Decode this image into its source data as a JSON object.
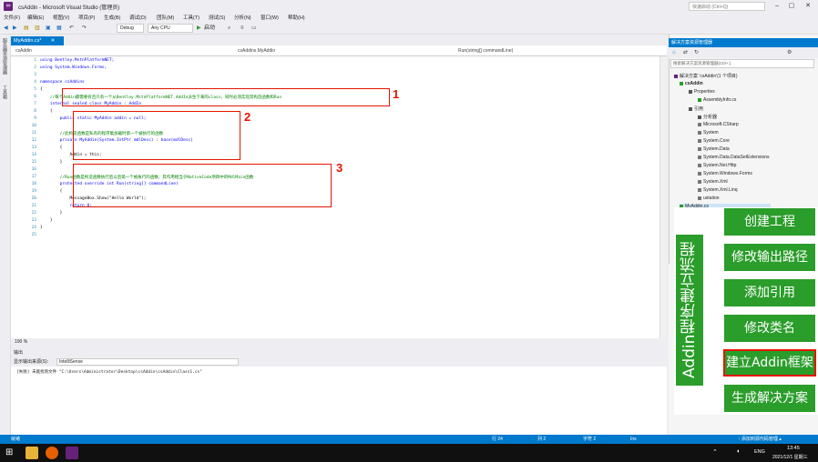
{
  "window": {
    "title": "csAddin - Microsoft Visual Studio (管理员)",
    "quick_launch": "快速启动 (Ctrl+Q)"
  },
  "menu": [
    "文件(F)",
    "编辑(E)",
    "视图(V)",
    "项目(P)",
    "生成(B)",
    "调试(D)",
    "团队(M)",
    "工具(T)",
    "测试(S)",
    "分析(N)",
    "窗口(W)",
    "帮助(H)"
  ],
  "toolbar": {
    "config": "Debug",
    "platform": "Any CPU",
    "start": "启动"
  },
  "left_strip": [
    "服务器资源管理器",
    "工具箱"
  ],
  "editor": {
    "tab": "MyAddin.cs*",
    "nav": [
      "csAddin",
      "csAddins.MyAddin",
      "Run(string[] commandLine)"
    ],
    "zoom": "100 %",
    "lines": [
      {
        "n": "1",
        "t": "using Bentley.MstnPlatformNET;"
      },
      {
        "n": "2",
        "t": "using System.Windows.Forms;"
      },
      {
        "n": "3",
        "t": ""
      },
      {
        "n": "4",
        "t": "namespace csAddins"
      },
      {
        "n": "5",
        "t": "{"
      },
      {
        "n": "6",
        "t": "    //每个Addin都需要有且只有一个从Bentley.MstnPlatformNET.AddIn派生下来的class，同时必须实现其构造函数和Run"
      },
      {
        "n": "7",
        "t": "    internal sealed class MyAddin : AddIn"
      },
      {
        "n": "8",
        "t": "    {"
      },
      {
        "n": "9",
        "t": "        public static MyAddin addin = null;"
      },
      {
        "n": "10",
        "t": ""
      },
      {
        "n": "11",
        "t": "        //此构造函数是私有的程序集加载时第一个被执行的函数"
      },
      {
        "n": "12",
        "t": "        private MyAddin(System.IntPtr mdlDesc) : base(mdlDesc)"
      },
      {
        "n": "13",
        "t": "        {"
      },
      {
        "n": "14",
        "t": "            Addin = this;"
      },
      {
        "n": "15",
        "t": "        }"
      },
      {
        "n": "16",
        "t": ""
      },
      {
        "n": "17",
        "t": "        //Run函数是构造函数执行后以后第一个被执行的函数，其作用相当于NativeCode项目中的MdlMain函数"
      },
      {
        "n": "18",
        "t": "        protected override int Run(string[] commandLine)"
      },
      {
        "n": "19",
        "t": "        {"
      },
      {
        "n": "20",
        "t": "            MessageBox.Show(\"Hello World\");"
      },
      {
        "n": "21",
        "t": "            return 0;"
      },
      {
        "n": "22",
        "t": "        }"
      },
      {
        "n": "23",
        "t": "    }"
      },
      {
        "n": "24",
        "t": "}"
      },
      {
        "n": "25",
        "t": ""
      }
    ],
    "markers": [
      "1",
      "2",
      "3"
    ]
  },
  "output": {
    "title": "输出",
    "source_label": "显示输出来源(S):",
    "source_value": "IntelliSense",
    "line": "[失败] 未能找到文件 \"C:\\Users\\Administrator\\Desktop\\csAddin\\csAddin\\Class1.cs\""
  },
  "status": {
    "left": "就绪",
    "row": "行 24",
    "col": "列 2",
    "char": "字符 2",
    "ins": "Ins",
    "right": "↑ 添加到源代码管理 ▴"
  },
  "solution": {
    "title": "解决方案资源管理器",
    "search": "搜索解决方案资源管理器(Ctrl+;)",
    "items": [
      "解决方案 'csAddin'(1 个项目)",
      "csAddin",
      "Properties",
      "AssemblyInfo.cs",
      "引用",
      "分析器",
      "Microsoft.CSharp",
      "System",
      "System.Core",
      "System.Data",
      "System.Data.DataSetExtensions",
      "System.Net.Http",
      "System.Windows.Forms",
      "System.Xml",
      "System.Xml.Linq",
      "ustation",
      "MyAddin.cs"
    ]
  },
  "overlay": {
    "vertical_title": "Addin程序建立流程",
    "steps": [
      "创建工程",
      "修改输出路径",
      "添加引用",
      "修改类名",
      "建立Addin框架",
      "生成解决方案"
    ],
    "highlighted_step": "建立Addin框架"
  },
  "taskbar": {
    "lang": "ENG",
    "time": "13:45",
    "date": "2021/12/1 星期三"
  },
  "colors": {
    "accent": "#007acc",
    "highlight_red": "#e51400",
    "step_green": "#2a9d2a"
  }
}
